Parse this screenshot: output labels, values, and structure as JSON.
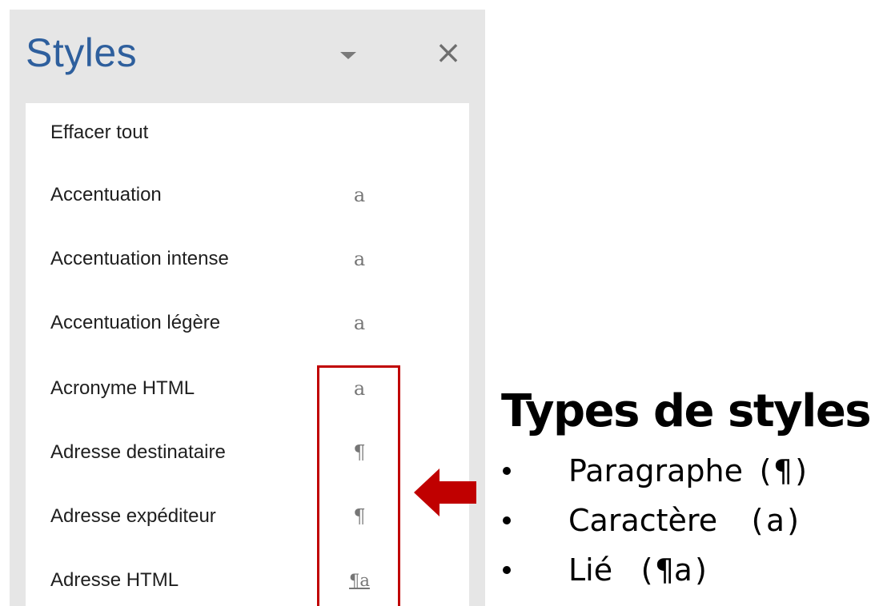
{
  "pane": {
    "title": "Styles",
    "dropdown_icon": "chevron-down-icon",
    "close_icon": "close-icon",
    "close_glyph": "×"
  },
  "styles_list": [
    {
      "label": "Effacer tout",
      "type_glyph": ""
    },
    {
      "label": "Accentuation",
      "type_glyph": "a"
    },
    {
      "label": "Accentuation intense",
      "type_glyph": "a"
    },
    {
      "label": "Accentuation légère",
      "type_glyph": "a"
    },
    {
      "label": "Acronyme HTML",
      "type_glyph": "a"
    },
    {
      "label": "Adresse destinataire",
      "type_glyph": "¶"
    },
    {
      "label": "Adresse expéditeur",
      "type_glyph": "¶"
    },
    {
      "label": "Adresse HTML",
      "type_glyph": "¶a"
    }
  ],
  "legend": {
    "title": "Types de styles",
    "items": [
      {
        "label": "Paragraphe",
        "symbol": "(¶)"
      },
      {
        "label": "Caractère",
        "symbol": "(a)"
      },
      {
        "label": "Lié",
        "symbol": "(¶a)"
      }
    ]
  },
  "colors": {
    "pane_background": "#e6e6e6",
    "title_blue": "#2e5f9d",
    "highlight_red": "#c00000"
  }
}
